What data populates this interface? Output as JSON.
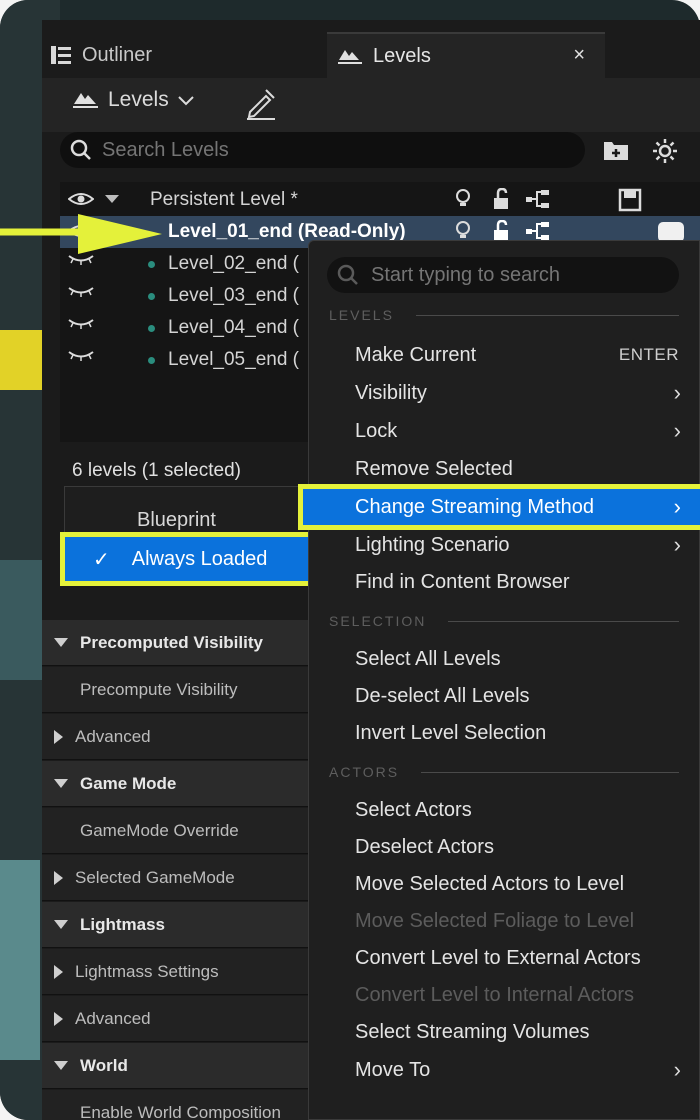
{
  "tabs": {
    "outliner": "Outliner",
    "levels": "Levels",
    "close": "×"
  },
  "toolbar": {
    "levels_dropdown": "Levels"
  },
  "search": {
    "placeholder": "Search Levels"
  },
  "levels": {
    "persistent": "Persistent Level *",
    "rows": [
      "Level_01_end (Read-Only)",
      "Level_02_end (",
      "Level_03_end (",
      "Level_04_end (",
      "Level_05_end ("
    ],
    "count": "6 levels (1 selected)"
  },
  "details": [
    {
      "label": "Precomputed Visibility",
      "kind": "section"
    },
    {
      "label": "Precompute Visibility",
      "kind": "item"
    },
    {
      "label": "Advanced",
      "kind": "collapsed"
    },
    {
      "label": "Game Mode",
      "kind": "section"
    },
    {
      "label": "GameMode Override",
      "kind": "item"
    },
    {
      "label": "Selected GameMode",
      "kind": "collapsed"
    },
    {
      "label": "Lightmass",
      "kind": "section"
    },
    {
      "label": "Lightmass Settings",
      "kind": "collapsed"
    },
    {
      "label": "Advanced",
      "kind": "collapsed"
    },
    {
      "label": "World",
      "kind": "section"
    },
    {
      "label": "Enable World Composition",
      "kind": "item"
    }
  ],
  "streaming_submenu": {
    "blueprint": "Blueprint",
    "always_loaded": "Always Loaded",
    "check": "✓"
  },
  "context_menu": {
    "search_placeholder": "Start typing to search",
    "headings": {
      "levels": "LEVELS",
      "selection": "SELECTION",
      "actors": "ACTORS"
    },
    "make_current": "Make Current",
    "make_current_shortcut": "ENTER",
    "visibility": "Visibility",
    "lock": "Lock",
    "remove_selected": "Remove Selected",
    "change_streaming": "Change Streaming Method",
    "lighting_scenario": "Lighting Scenario",
    "find_in_browser": "Find in Content Browser",
    "select_all": "Select All Levels",
    "deselect_all": "De-select All Levels",
    "invert_selection": "Invert Level Selection",
    "select_actors": "Select Actors",
    "deselect_actors": "Deselect Actors",
    "move_selected_actors": "Move Selected Actors to Level",
    "move_selected_foliage": "Move Selected Foliage to Level",
    "convert_external": "Convert Level to External Actors",
    "convert_internal": "Convert Level to Internal Actors",
    "select_streaming_volumes": "Select Streaming Volumes",
    "move_to": "Move To",
    "chevron": "›"
  },
  "colors": {
    "highlight": "#0b72dc",
    "callout": "#e4f13a",
    "selected_row": "#33475e"
  }
}
